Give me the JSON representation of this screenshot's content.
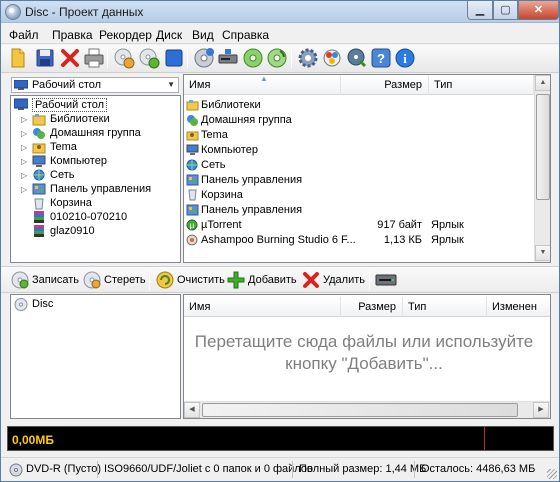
{
  "window": {
    "title": "Disc - Проект данных"
  },
  "menu": [
    "Файл",
    "Правка",
    "Рекордер",
    "Диск",
    "Вид",
    "Справка"
  ],
  "source_combo": {
    "value": "Рабочий стол"
  },
  "tree": [
    {
      "label": "Рабочий стол",
      "level": 0,
      "icon": "desktop-icon",
      "selected": true
    },
    {
      "label": "Библиотеки",
      "level": 1,
      "icon": "libraries-icon"
    },
    {
      "label": "Домашняя группа",
      "level": 1,
      "icon": "homegroup-icon"
    },
    {
      "label": "Tema",
      "level": 1,
      "icon": "user-folder-icon"
    },
    {
      "label": "Компьютер",
      "level": 1,
      "icon": "computer-icon"
    },
    {
      "label": "Сеть",
      "level": 1,
      "icon": "network-icon"
    },
    {
      "label": "Панель управления",
      "level": 1,
      "icon": "control-panel-icon"
    },
    {
      "label": "Корзина",
      "level": 1,
      "icon": "recycle-bin-icon"
    },
    {
      "label": "010210-070210",
      "level": 1,
      "icon": "archive-icon"
    },
    {
      "label": "glaz0910",
      "level": 1,
      "icon": "archive-icon"
    }
  ],
  "file_list": {
    "columns": [
      "Имя",
      "Размер",
      "Тип"
    ],
    "rows": [
      {
        "name": "Библиотеки",
        "size": "",
        "type": "",
        "icon": "libraries-icon"
      },
      {
        "name": "Домашняя группа",
        "size": "",
        "type": "",
        "icon": "homegroup-icon"
      },
      {
        "name": "Tema",
        "size": "",
        "type": "",
        "icon": "user-folder-icon"
      },
      {
        "name": "Компьютер",
        "size": "",
        "type": "",
        "icon": "computer-icon"
      },
      {
        "name": "Сеть",
        "size": "",
        "type": "",
        "icon": "network-icon"
      },
      {
        "name": "Панель управления",
        "size": "",
        "type": "",
        "icon": "control-panel-icon"
      },
      {
        "name": "Корзина",
        "size": "",
        "type": "",
        "icon": "recycle-bin-icon"
      },
      {
        "name": "Панель управления",
        "size": "",
        "type": "",
        "icon": "control-panel-icon"
      },
      {
        "name": "µTorrent",
        "size": "917 байт",
        "type": "Ярлык",
        "icon": "utorrent-icon"
      },
      {
        "name": "Ashampoo Burning Studio 6 F...",
        "size": "1,13 КБ",
        "type": "Ярлык",
        "icon": "ashampoo-icon"
      }
    ]
  },
  "actions": {
    "burn": "Записать",
    "erase": "Стереть",
    "clear": "Очистить",
    "add": "Добавить",
    "remove": "Удалить"
  },
  "project_tree": {
    "root": "Disc"
  },
  "project_list": {
    "columns": [
      "Имя",
      "Размер",
      "Тип",
      "Изменен"
    ],
    "empty_message_line1": "Перетащите сюда файлы или используйте",
    "empty_message_line2": "кнопку \"Добавить\"..."
  },
  "meter": {
    "used": "0,00МБ"
  },
  "status": {
    "disc": "DVD-R (Пусто)",
    "filesystem": "ISO9660/UDF/Joliet с 0 папок и 0 файлов",
    "total_size": "Полный размер: 1,44 МБ",
    "remaining": "Осталось: 4486,63 МБ"
  }
}
